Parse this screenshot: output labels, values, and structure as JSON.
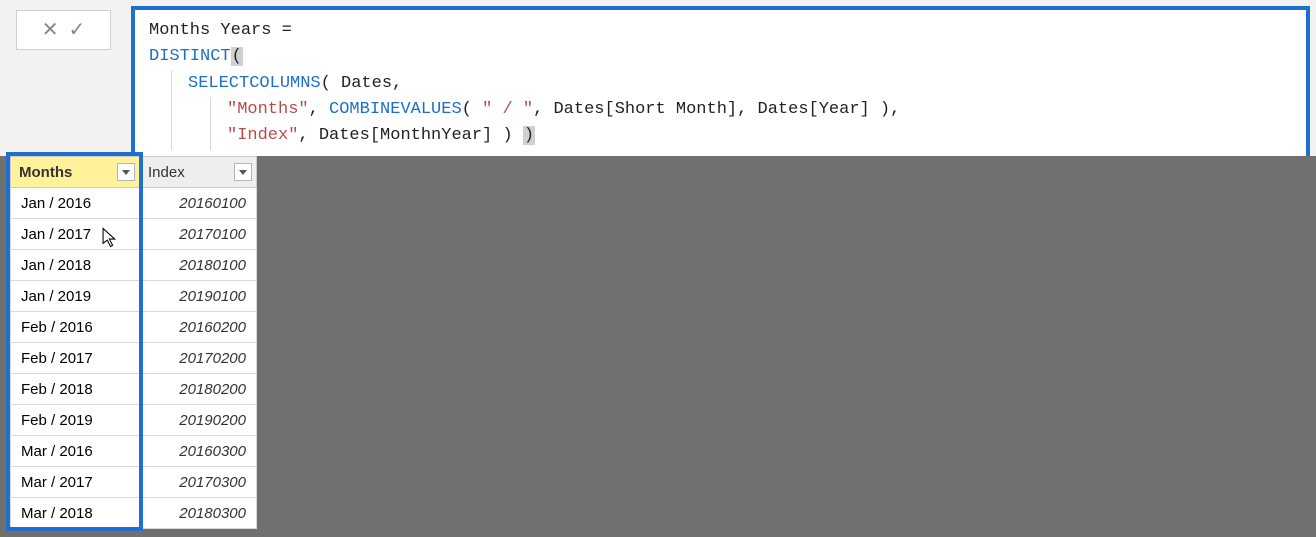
{
  "actions": {
    "cancel_glyph": "✕",
    "confirm_glyph": "✓"
  },
  "formula": {
    "line1_name": "Months Years ",
    "line1_eq": "=",
    "line2_fn": "DISTINCT",
    "line2_paren": "(",
    "line3_fn": "SELECTCOLUMNS",
    "line3_rest": "( Dates,",
    "line4_str": "\"Months\"",
    "line4_sep": ", ",
    "line4_fn": "COMBINEVALUES",
    "line4_rest_a": "( ",
    "line4_str2": "\" / \"",
    "line4_rest_b": ", Dates[Short Month], Dates[Year] ),",
    "line5_str": "\"Index\"",
    "line5_rest": ", Dates[MonthnYear] ) ",
    "line5_close": ")"
  },
  "columns": {
    "months": "Months",
    "index": "Index"
  },
  "rows": [
    {
      "months": "Jan / 2016",
      "index": "20160100"
    },
    {
      "months": "Jan / 2017",
      "index": "20170100"
    },
    {
      "months": "Jan / 2018",
      "index": "20180100"
    },
    {
      "months": "Jan / 2019",
      "index": "20190100"
    },
    {
      "months": "Feb / 2016",
      "index": "20160200"
    },
    {
      "months": "Feb / 2017",
      "index": "20170200"
    },
    {
      "months": "Feb / 2018",
      "index": "20180200"
    },
    {
      "months": "Feb / 2019",
      "index": "20190200"
    },
    {
      "months": "Mar / 2016",
      "index": "20160300"
    },
    {
      "months": "Mar / 2017",
      "index": "20170300"
    },
    {
      "months": "Mar / 2018",
      "index": "20180300"
    }
  ]
}
